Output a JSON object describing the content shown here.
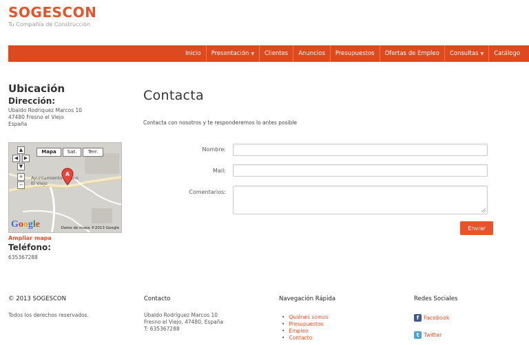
{
  "brand": {
    "name": "SOGESCON",
    "tagline": "Tu Compañía de Construcción"
  },
  "nav": {
    "items": [
      {
        "label": "Inicio",
        "dropdown": false
      },
      {
        "label": "Presentación",
        "dropdown": true
      },
      {
        "label": "Clientes",
        "dropdown": false
      },
      {
        "label": "Anuncios",
        "dropdown": false
      },
      {
        "label": "Presupuestos",
        "dropdown": false
      },
      {
        "label": "Ofertas de Empleo",
        "dropdown": false
      },
      {
        "label": "Consultas",
        "dropdown": true
      },
      {
        "label": "Catálogo",
        "dropdown": false
      }
    ]
  },
  "sidebar": {
    "title": "Ubicación",
    "address_heading": "Dirección:",
    "address_lines": [
      "Ubaldo Rodriquez Marcos 10",
      "47480 Fresno el Viejo",
      "España"
    ],
    "map": {
      "types": [
        "Mapa",
        "Sat.",
        "Terr."
      ],
      "active_type": "Mapa",
      "place_label": "Ayuntamiento Fresno El Viejo",
      "credit": "Datos de mapa ©2013 Google",
      "logo_letters": [
        "G",
        "o",
        "o",
        "g",
        "l",
        "e"
      ]
    },
    "enlarge_link": "Ampliar mapa",
    "phone_heading": "Teléfono:",
    "phone": "635367288"
  },
  "main": {
    "title": "Contacta",
    "intro": "Contacta con nosotros y te responderemos lo antes posible",
    "form": {
      "name_label": "Nombre:",
      "mail_label": "Mail:",
      "comments_label": "Comentarios:",
      "submit_label": "Enviar"
    }
  },
  "footer": {
    "copyright": "© 2013 SOGESCON",
    "rights": "Todos los derechos reservados.",
    "contact_heading": "Contacto",
    "contact_lines": [
      "Ubaldo Rodríguez Marcos 10",
      "Fresno el Viejo, 47480, España",
      "T: 635367288"
    ],
    "quicknav_heading": "Navegación Rápida",
    "quicknav_links": [
      "Quiénes somos",
      "Presupuestos",
      "Empleo",
      "Contacto"
    ],
    "social_heading": "Redes Sociales",
    "social": [
      {
        "label": "Facebook",
        "icon": "facebook-icon",
        "color": "#3b5998"
      },
      {
        "label": "Twitter",
        "icon": "twitter-icon",
        "color": "#4aa3df"
      }
    ]
  },
  "colors": {
    "accent": "#e8532a",
    "nav_bg": "#de4a1f"
  }
}
